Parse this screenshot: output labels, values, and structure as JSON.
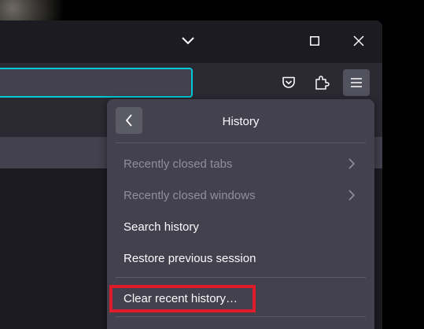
{
  "panel": {
    "title": "History",
    "items": [
      {
        "label": "Recently closed tabs",
        "disabled": true,
        "has_submenu": true
      },
      {
        "label": "Recently closed windows",
        "disabled": true,
        "has_submenu": true
      },
      {
        "label": "Search history",
        "disabled": false,
        "has_submenu": false
      },
      {
        "label": "Restore previous session",
        "disabled": false,
        "has_submenu": false
      },
      {
        "label": "Clear recent history…",
        "disabled": false,
        "has_submenu": false
      }
    ]
  },
  "toolbar": {
    "icons": [
      "pocket-icon",
      "extensions-icon",
      "app-menu-icon"
    ]
  },
  "titlebar": {
    "buttons": [
      "tab-list-chevron-icon",
      "maximize-icon",
      "close-icon"
    ]
  },
  "colors": {
    "panel_bg": "#42414d",
    "toolbar_bg": "#2b2a33",
    "url_focus": "#00c8d7",
    "highlight": "#e01b2a"
  }
}
